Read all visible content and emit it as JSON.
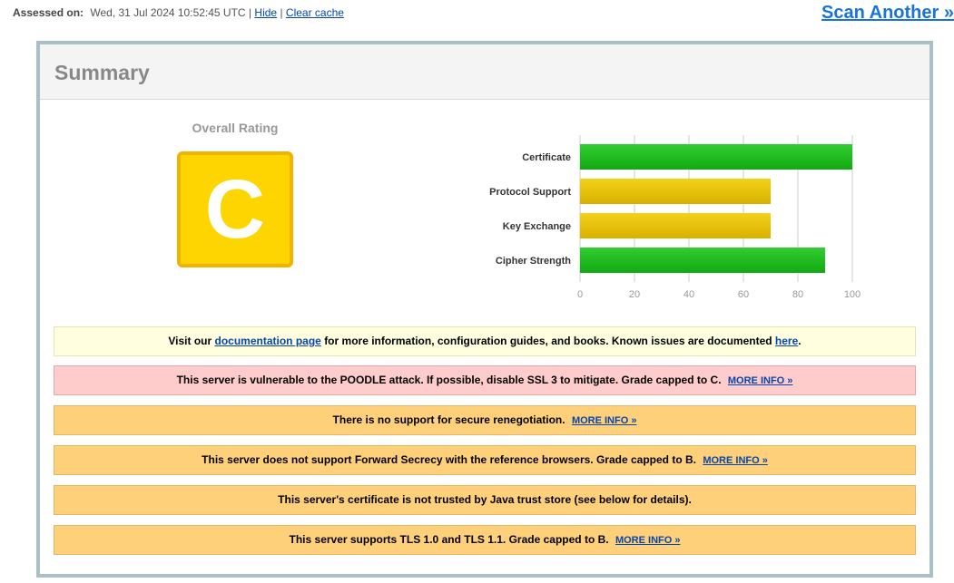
{
  "header": {
    "assessed_label": "Assessed on:",
    "assessed_value": "Wed, 31 Jul 2024 10:52:45 UTC",
    "sep1": "|",
    "hide_link": "Hide",
    "sep2": "|",
    "clear_cache_link": "Clear cache",
    "scan_another": "Scan Another »"
  },
  "summary": {
    "title": "Summary",
    "overall_rating_label": "Overall Rating",
    "grade": "C",
    "grade_color": "#ffd500"
  },
  "chart_data": {
    "type": "bar",
    "orientation": "horizontal",
    "categories": [
      "Certificate",
      "Protocol Support",
      "Key Exchange",
      "Cipher Strength"
    ],
    "values": [
      100,
      70,
      70,
      90
    ],
    "colors": [
      "#22bb22",
      "#e6c200",
      "#e6c200",
      "#22bb22"
    ],
    "xticks": [
      "0",
      "20",
      "40",
      "60",
      "80",
      "100"
    ],
    "xlim": [
      0,
      100
    ],
    "grid": true
  },
  "messages": {
    "doc": {
      "pre": "Visit our",
      "link1": "documentation page",
      "mid": "for more information, configuration guides, and books. Known issues are documented",
      "link2": "here",
      "post": "."
    },
    "poodle": {
      "text": "This server is vulnerable to the POODLE attack. If possible, disable SSL 3 to mitigate. Grade capped to C.",
      "link": "MORE INFO »"
    },
    "renegotiation": {
      "text": "There is no support for secure renegotiation.",
      "link": "MORE INFO »"
    },
    "forward_secrecy": {
      "text": "This server does not support Forward Secrecy with the reference browsers. Grade capped to B.",
      "link": "MORE INFO »"
    },
    "java_trust": {
      "text": "This server's certificate is not trusted by Java trust store (see below for details)."
    },
    "tls_old": {
      "text": "This server supports TLS 1.0 and TLS 1.1. Grade capped to B.",
      "link": "MORE INFO »"
    }
  }
}
